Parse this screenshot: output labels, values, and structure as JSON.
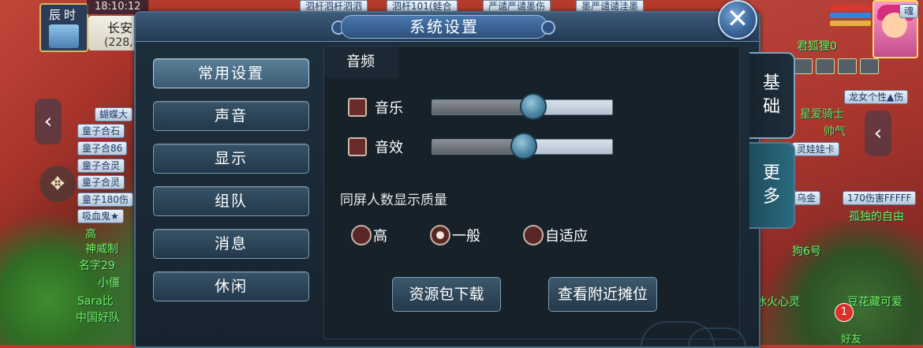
{
  "hud": {
    "time_label": "辰时",
    "clock": "18:10:12",
    "location_name": "长安",
    "location_coords": "(228,"
  },
  "topbar_tags": [
    "泗杆泗杆泗泗",
    "泗杆101(蛙合",
    "严谴严谴墨伤",
    "墨严谴谴洼墨"
  ],
  "left_plates": [
    "蝴蝶大",
    "童子合石",
    "童子合86",
    "童子合灵",
    "童子合灵",
    "童子180伤",
    "吸血鬼★"
  ],
  "left_green": [
    "高",
    "神威制",
    "名字29",
    "小僵",
    "Sara比",
    "中国好队"
  ],
  "right_labels": {
    "plate_top": "龙女个性▲伤",
    "fox": "君狐狸0",
    "star": "星爱骑士",
    "handsome": "帅气",
    "doll": "灵娃娃卡",
    "gold": "乌金",
    "dmg": "170伤害FFFFF",
    "lonely": "孤独的自由",
    "num6": "狗6号",
    "ice": "冰火心灵",
    "bean": "豆花藏可爱",
    "friend": "好友",
    "badge": "1",
    "name_top": "魂"
  },
  "dialog": {
    "title": "系统设置",
    "close_symbol": "✕",
    "nav": [
      {
        "label": "常用设置",
        "active": true
      },
      {
        "label": "声音",
        "active": false
      },
      {
        "label": "显示",
        "active": false
      },
      {
        "label": "组队",
        "active": false
      },
      {
        "label": "消息",
        "active": false
      },
      {
        "label": "休闲",
        "active": false
      }
    ],
    "section_title": "音频",
    "audio": [
      {
        "label": "音乐",
        "checked": false,
        "level": 0.56
      },
      {
        "label": "音效",
        "checked": false,
        "level": 0.51
      }
    ],
    "quality_label": "同屏人数显示质量",
    "quality_options": [
      {
        "label": "高",
        "checked": false
      },
      {
        "label": "一般",
        "checked": true
      },
      {
        "label": "自适应",
        "checked": false
      }
    ],
    "buttons": {
      "download": "资源包下载",
      "nearby": "查看附近摊位"
    },
    "side_tabs": [
      {
        "line1": "基",
        "line2": "础",
        "active": true
      },
      {
        "line1": "更",
        "line2": "多",
        "active": false
      }
    ]
  },
  "colors": {
    "dialog_bg": "#17242f",
    "accent_blue": "#4a78ae",
    "checkbox_fill": "#6a2b2b"
  }
}
